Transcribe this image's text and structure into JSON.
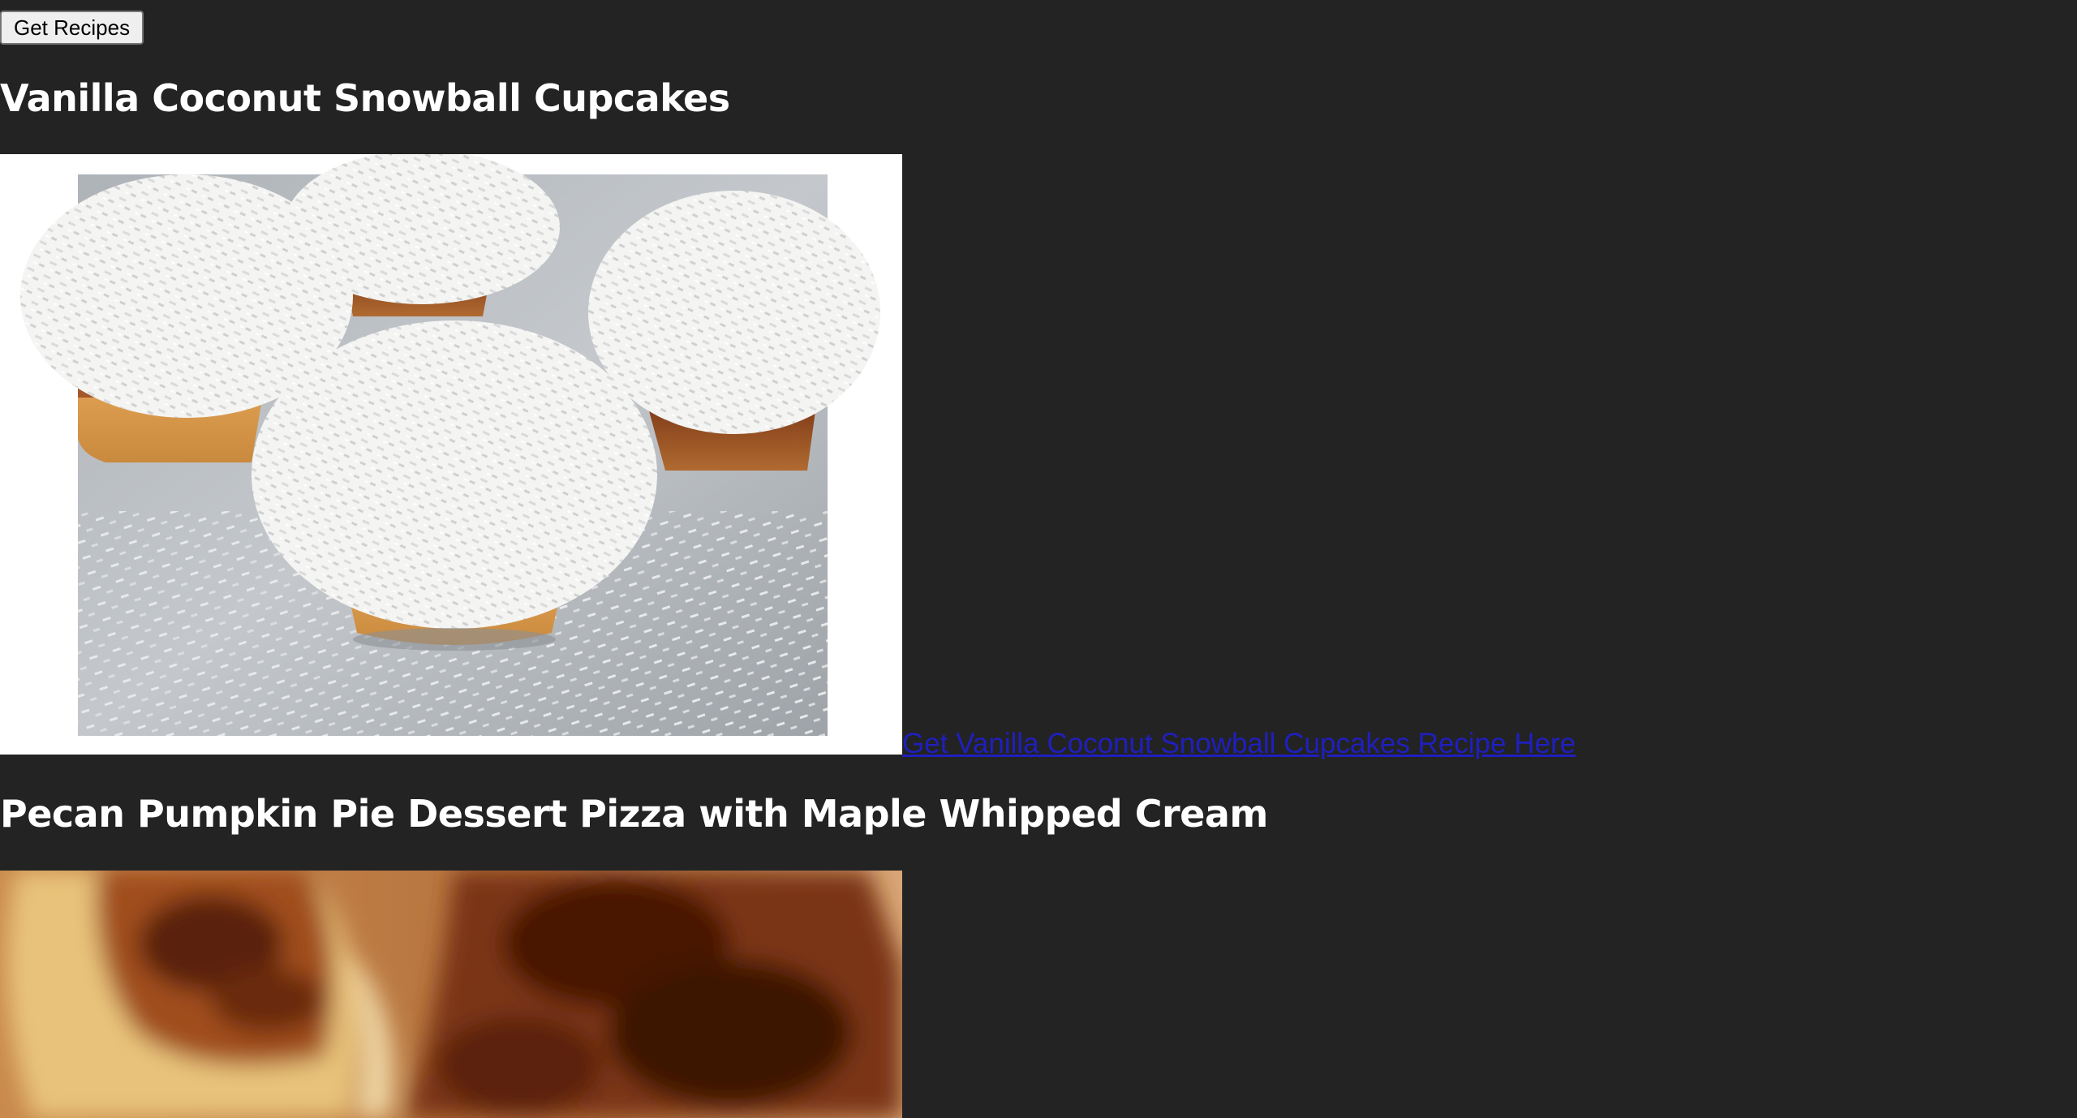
{
  "controls": {
    "get_recipes_label": "Get Recipes"
  },
  "recipes": [
    {
      "title": "Vanilla Coconut Snowball Cupcakes",
      "image_alt": "Vanilla Coconut Snowball Cupcakes",
      "link_text": "Get Vanilla Coconut Snowball Cupcakes Recipe Here"
    },
    {
      "title": "Pecan Pumpkin Pie Dessert Pizza with Maple Whipped Cream",
      "image_alt": "Pecan Pumpkin Pie Dessert Pizza with Maple Whipped Cream"
    }
  ],
  "colors": {
    "page_background": "#232323",
    "heading_text": "#ffffff",
    "link": "#1f1fbf"
  }
}
